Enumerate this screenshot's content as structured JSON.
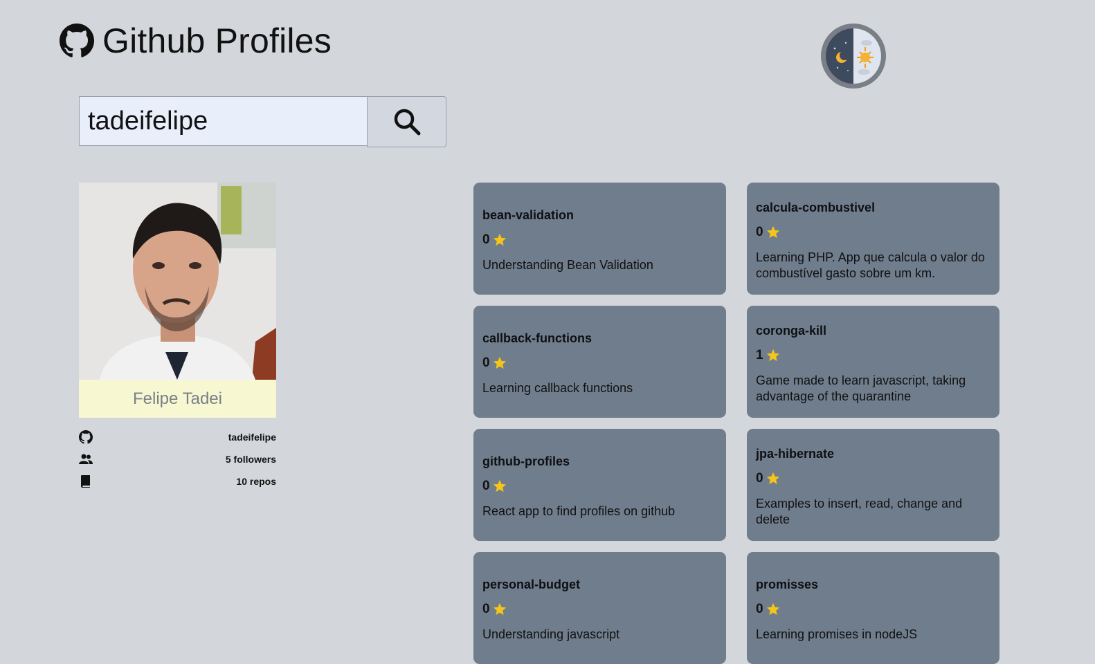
{
  "header": {
    "title": "Github Profiles"
  },
  "search": {
    "value": "tadeifelipe",
    "placeholder": ""
  },
  "profile": {
    "name": "Felipe Tadei",
    "username": "tadeifelipe",
    "followers": "5 followers",
    "repos": "10 repos"
  },
  "repos": [
    {
      "name": "bean-validation",
      "stars": "0",
      "description": "Understanding Bean Validation"
    },
    {
      "name": "calcula-combustivel",
      "stars": "0",
      "description": "Learning PHP. App que calcula o valor do combustível gasto sobre um km."
    },
    {
      "name": "callback-functions",
      "stars": "0",
      "description": "Learning callback functions"
    },
    {
      "name": "coronga-kill",
      "stars": "1",
      "description": "Game made to learn javascript, taking advantage of the quarantine"
    },
    {
      "name": "github-profiles",
      "stars": "0",
      "description": "React app to find profiles on github"
    },
    {
      "name": "jpa-hibernate",
      "stars": "0",
      "description": "Examples to insert, read, change and delete"
    },
    {
      "name": "personal-budget",
      "stars": "0",
      "description": "Understanding javascript"
    },
    {
      "name": "promisses",
      "stars": "0",
      "description": "Learning promises in nodeJS"
    }
  ],
  "colors": {
    "background": "#d3d6db",
    "card": "#707d8d",
    "name_bg": "#f7f7d2",
    "star": "#f5c518"
  }
}
